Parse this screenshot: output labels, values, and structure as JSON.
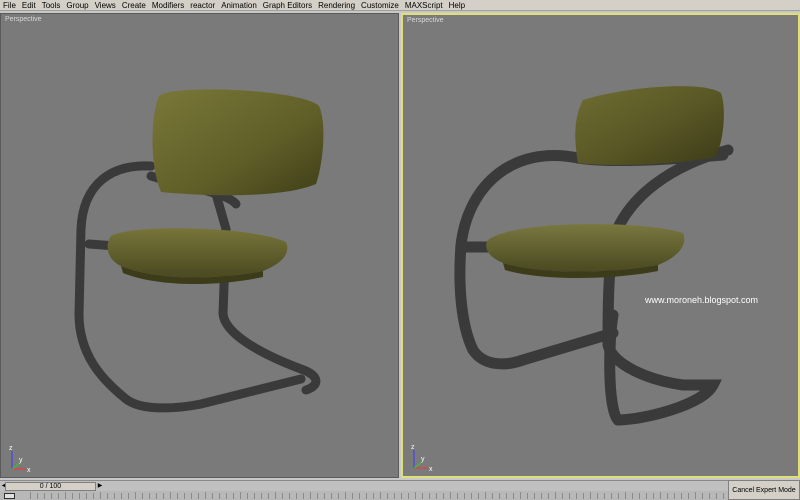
{
  "menu": [
    "File",
    "Edit",
    "Tools",
    "Group",
    "Views",
    "Create",
    "Modifiers",
    "reactor",
    "Animation",
    "Graph Editors",
    "Rendering",
    "Customize",
    "MAXScript",
    "Help"
  ],
  "viewports": {
    "left": {
      "label": "Perspective"
    },
    "right": {
      "label": "Perspective"
    }
  },
  "watermark": "www.moroneh.blogspot.com",
  "axis": {
    "x": "x",
    "y": "y",
    "z": "z"
  },
  "timeline": {
    "frame": "0 / 100"
  },
  "expert_mode_button": "Cancel Expert Mode",
  "colors": {
    "viewport_bg": "#7a7a7a",
    "active_border": "#e0df77",
    "cushion": "#6b6a2e",
    "frame": "#3c3c3c"
  }
}
